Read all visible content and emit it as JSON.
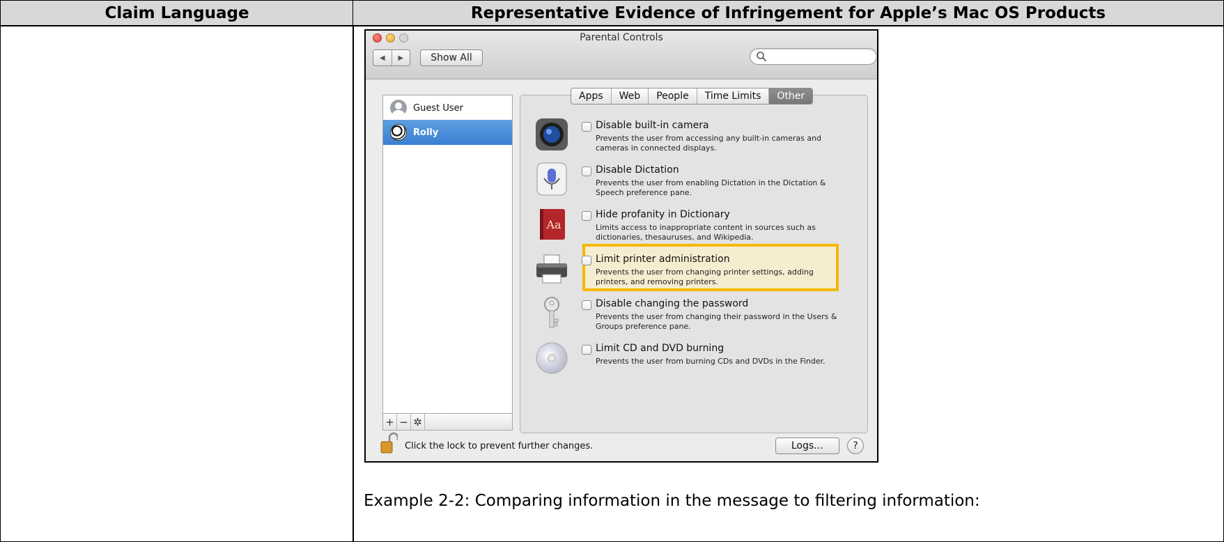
{
  "table": {
    "col_left_header": "Claim Language",
    "col_right_header": "Representative Evidence of Infringement for Apple’s Mac OS Products",
    "caption": "Example 2-2: Comparing information in the message to filtering information:"
  },
  "window": {
    "title": "Parental Controls",
    "nav_back": "◀",
    "nav_forward": "▶",
    "show_all": "Show All",
    "search_placeholder": ""
  },
  "users": [
    {
      "name": "Guest User",
      "avatar": "guest-avatar-icon",
      "selected": false
    },
    {
      "name": "Rolly",
      "avatar": "soccer-ball-icon",
      "selected": true
    }
  ],
  "list_tools": {
    "add": "+",
    "remove": "−",
    "action": "✲"
  },
  "tabs": [
    {
      "label": "Apps",
      "active": false
    },
    {
      "label": "Web",
      "active": false
    },
    {
      "label": "People",
      "active": false
    },
    {
      "label": "Time Limits",
      "active": false
    },
    {
      "label": "Other",
      "active": true
    }
  ],
  "options": [
    {
      "icon": "camera-icon",
      "title": "Disable built-in camera",
      "description": "Prevents the user from accessing any built-in cameras and cameras in connected displays.",
      "checked": false
    },
    {
      "icon": "microphone-icon",
      "title": "Disable Dictation",
      "description": "Prevents the user from enabling Dictation in the Dictation & Speech preference pane.",
      "checked": false
    },
    {
      "icon": "dictionary-icon",
      "title": "Hide profanity in Dictionary",
      "description": "Limits access to inappropriate content in sources such as dictionaries, thesauruses, and Wikipedia.",
      "checked": false,
      "highlighted": true
    },
    {
      "icon": "printer-icon",
      "title": "Limit printer administration",
      "description": "Prevents the user from changing printer settings, adding printers, and removing printers.",
      "checked": false
    },
    {
      "icon": "key-icon",
      "title": "Disable changing the password",
      "description": "Prevents the user from changing their password in the Users & Groups preference pane.",
      "checked": false
    },
    {
      "icon": "disc-icon",
      "title": "Limit CD and DVD burning",
      "description": "Prevents the user from burning CDs and DVDs in the Finder.",
      "checked": false
    }
  ],
  "footer": {
    "lock_text": "Click the lock to prevent further changes.",
    "logs_button": "Logs…",
    "help_button": "?"
  },
  "colors": {
    "header_bg": "#d8d8d8",
    "selection_blue": "#3a7fd3",
    "highlight_border": "#f5b800",
    "highlight_fill": "#f6ecd0"
  }
}
